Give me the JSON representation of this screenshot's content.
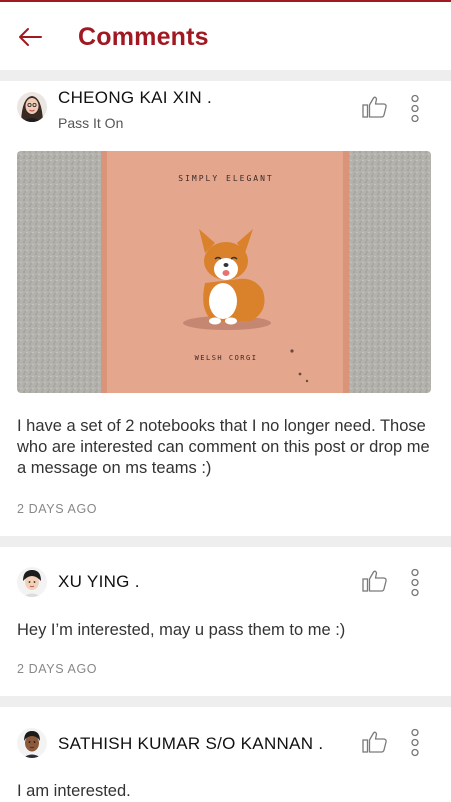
{
  "header": {
    "title": "Comments"
  },
  "icons": {
    "back": "arrow-left-icon",
    "like": "thumbs-up-icon",
    "more": "more-vertical-icon"
  },
  "colors": {
    "brand": "#a01822",
    "text": "#222222",
    "muted": "#888888",
    "divider": "#eeeeee"
  },
  "post": {
    "author": "CHEONG KAI XIN .",
    "subtitle": "Pass It On",
    "notebook_cover_text": "SIMPLY ELEGANT",
    "notebook_caption": "WELSH CORGI",
    "text": "I have a set of 2 notebooks that I no longer need. Those who are interested can comment on this post or drop me a message on ms teams :)",
    "time": "2 DAYS AGO"
  },
  "comments": [
    {
      "author": "XU YING .",
      "text": "Hey I’m interested, may u pass them to me :)",
      "time": "2 DAYS AGO"
    },
    {
      "author": "SATHISH KUMAR S/O KANNAN .",
      "text": "I am interested."
    }
  ]
}
